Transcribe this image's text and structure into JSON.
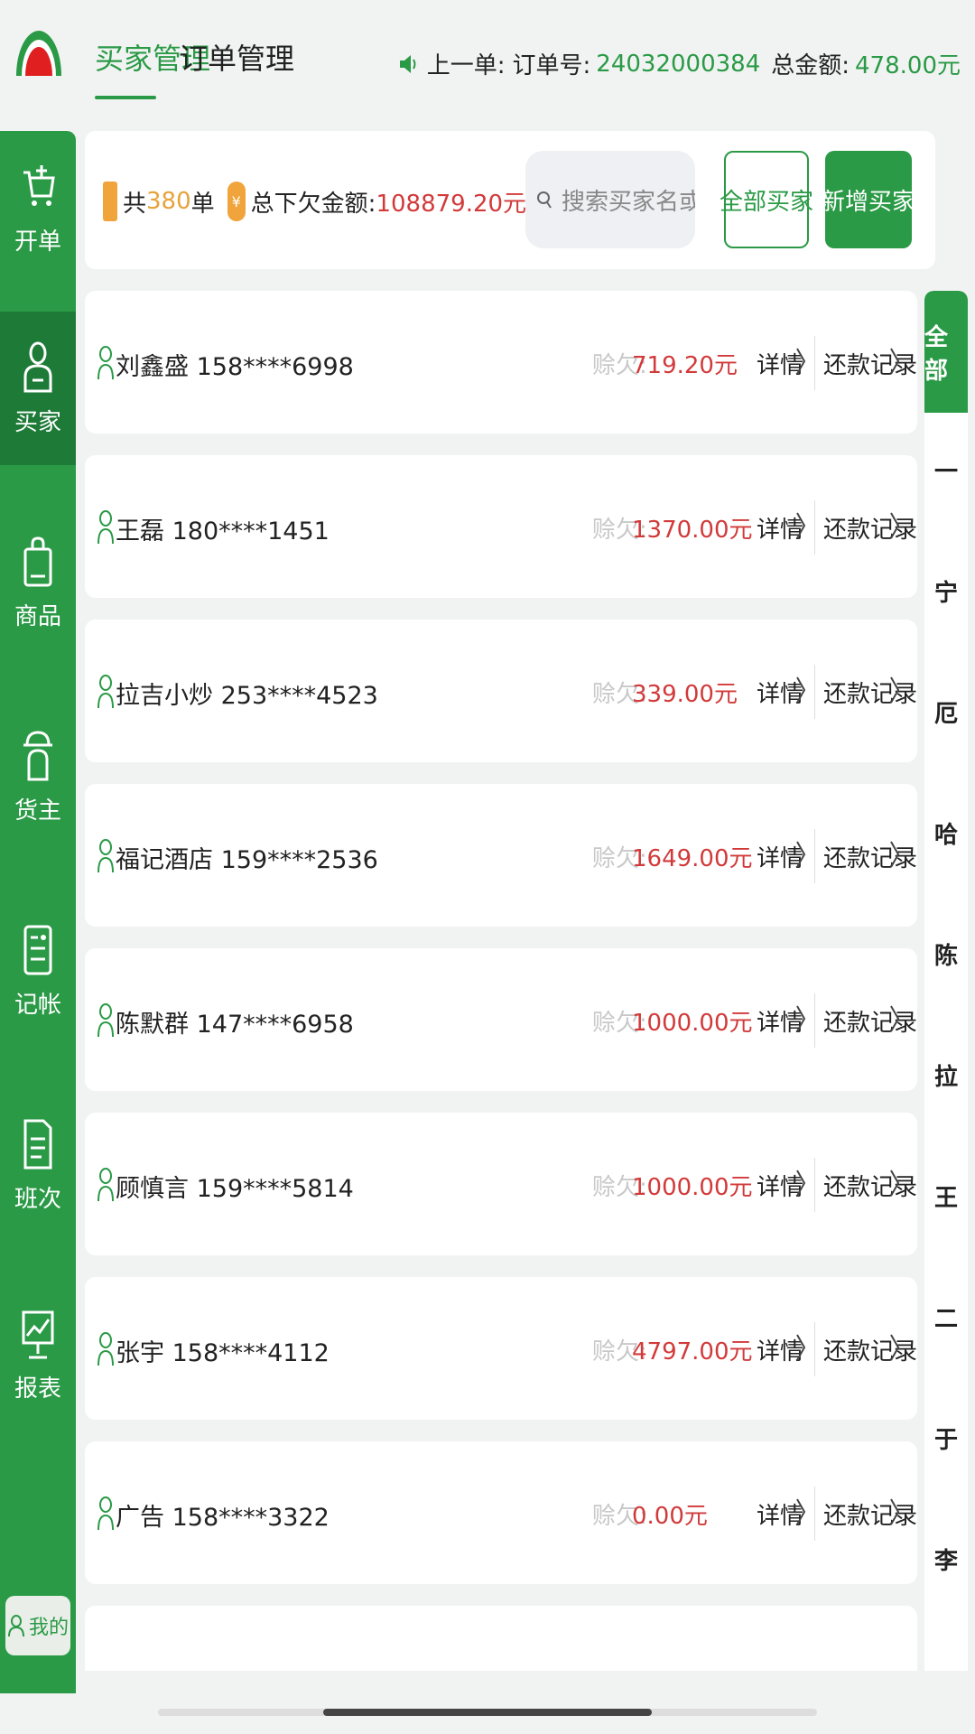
{
  "header": {
    "tabs": [
      {
        "label": "买家管理",
        "active": true
      },
      {
        "label": "订单管理",
        "active": false
      }
    ],
    "last_order": {
      "prefix": "上一单:",
      "order_label": "订单号:",
      "order_no": "24032000384",
      "total_label": "总金额:",
      "total": "478.00元"
    }
  },
  "sidebar": {
    "items": [
      {
        "label": "开单",
        "icon": "cart-icon"
      },
      {
        "label": "买家",
        "icon": "buyer-icon",
        "active": true
      },
      {
        "label": "商品",
        "icon": "product-icon"
      },
      {
        "label": "货主",
        "icon": "owner-icon"
      },
      {
        "label": "记帐",
        "icon": "ledger-icon"
      },
      {
        "label": "班次",
        "icon": "shift-icon"
      },
      {
        "label": "报表",
        "icon": "report-icon"
      }
    ],
    "mine_label": "我的"
  },
  "summary": {
    "count_prefix": "共",
    "count": "380",
    "count_suffix": "单",
    "owe_label": "总下欠金额:",
    "owe_total": "108879.20元",
    "search_placeholder": "搜索买家名或首字母",
    "btn_all": "全部买家",
    "btn_add": "新增买家"
  },
  "list": {
    "owe_label": "赊欠:",
    "detail_label": "详情",
    "repay_label": "还款记录",
    "rows": [
      {
        "name": "刘鑫盛 158****6998",
        "owe": "719.20元"
      },
      {
        "name": "王磊 180****1451",
        "owe": "1370.00元"
      },
      {
        "name": "拉吉小炒 253****4523",
        "owe": "339.00元"
      },
      {
        "name": "福记酒店 159****2536",
        "owe": "1649.00元"
      },
      {
        "name": "陈默群 147****6958",
        "owe": "1000.00元"
      },
      {
        "name": "顾慎言 159****5814",
        "owe": "1000.00元"
      },
      {
        "name": "张宇 158****4112",
        "owe": "4797.00元"
      },
      {
        "name": "广告 158****3322",
        "owe": "0.00元"
      }
    ]
  },
  "index_bar": {
    "all": "全部",
    "letters": [
      "一",
      "宁",
      "厄",
      "哈",
      "陈",
      "拉",
      "王",
      "二",
      "于",
      "李"
    ]
  },
  "colors": {
    "brand_green": "#2a9a46",
    "owe_red": "#d23a3a",
    "accent_orange": "#e6a33b"
  }
}
